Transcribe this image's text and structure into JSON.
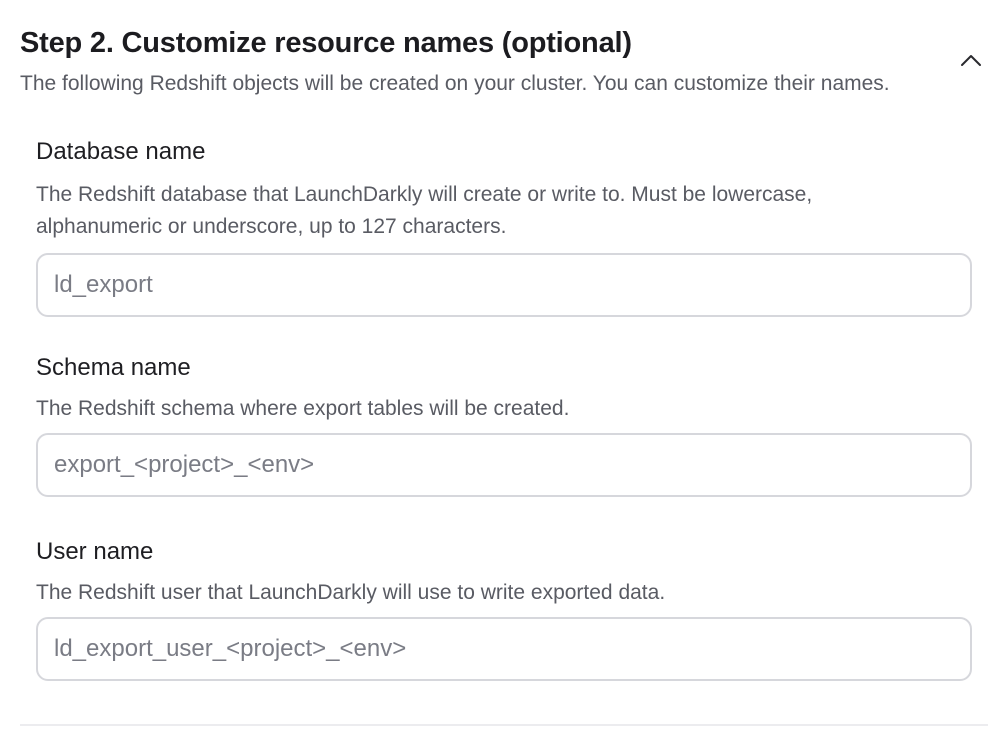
{
  "step": {
    "title": "Step 2. Customize resource names (optional)",
    "description": "The following Redshift objects will be created on your cluster. You can customize their names.",
    "collapse_icon": "chevron-up-icon"
  },
  "fields": {
    "database": {
      "label": "Database name",
      "help_line1": "The Redshift database that LaunchDarkly will create or write to. Must be lowercase,",
      "help_line2": "alphanumeric or underscore, up to 127 characters.",
      "value": "",
      "placeholder": "ld_export"
    },
    "schema": {
      "label": "Schema name",
      "help": "The Redshift schema where export tables will be created.",
      "value": "",
      "placeholder": "export_<project>_<env>"
    },
    "user": {
      "label": "User name",
      "help": "The Redshift user that LaunchDarkly will use to write exported data.",
      "value": "",
      "placeholder": "ld_export_user_<project>_<env>"
    }
  },
  "colors": {
    "title": "#1c1c20",
    "muted_text": "#595b63",
    "placeholder": "#7a7c85",
    "input_border": "#d6d7dc",
    "divider": "#ececef"
  }
}
